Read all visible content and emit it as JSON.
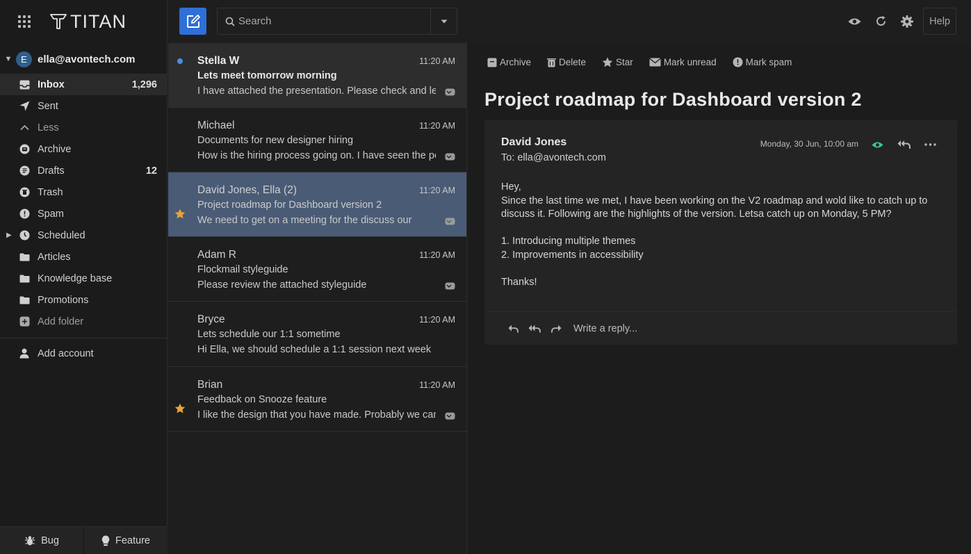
{
  "app": {
    "name": "TITAN"
  },
  "colors": {
    "accent": "#2f6fd6",
    "selected_row": "#4a5b76",
    "star": "#e8a23c",
    "unread_dot": "#4c8fe0",
    "eye_active": "#39c98a"
  },
  "search": {
    "placeholder": "Search"
  },
  "topbar": {
    "help_label": "Help",
    "icons": [
      "eye-icon",
      "refresh-icon",
      "gear-icon"
    ]
  },
  "account": {
    "avatar_letter": "E",
    "email": "ella@avontech.com"
  },
  "folders": [
    {
      "label": "Inbox",
      "count": "1,296",
      "icon": "inbox-icon",
      "active": true
    },
    {
      "label": "Sent",
      "count": "",
      "icon": "send-icon"
    },
    {
      "label": "Less",
      "count": "",
      "icon": "chevron-up-icon"
    },
    {
      "label": "Archive",
      "count": "",
      "icon": "archive-icon"
    },
    {
      "label": "Drafts",
      "count": "12",
      "icon": "drafts-icon"
    },
    {
      "label": "Trash",
      "count": "",
      "icon": "trash-icon"
    },
    {
      "label": "Spam",
      "count": "",
      "icon": "spam-icon"
    },
    {
      "label": "Scheduled",
      "count": "",
      "icon": "clock-icon"
    },
    {
      "label": "Articles",
      "count": "",
      "icon": "folder-icon"
    },
    {
      "label": "Knowledge base",
      "count": "",
      "icon": "folder-icon"
    },
    {
      "label": "Promotions",
      "count": "",
      "icon": "folder-icon"
    },
    {
      "label": "Add folder",
      "count": "",
      "icon": "add-folder-icon"
    }
  ],
  "add_account_label": "Add account",
  "sidebar_footer": {
    "bug_label": "Bug",
    "feature_label": "Feature"
  },
  "messages": [
    {
      "sender": "Stella W",
      "time": "11:20 AM",
      "subject": "Lets meet tomorrow morning",
      "preview": "I have attached the presentation. Please check and let me know",
      "unread": true,
      "starred": false,
      "selected": false
    },
    {
      "sender": "Michael",
      "time": "11:20 AM",
      "subject": "Documents for new designer hiring",
      "preview": "How is the hiring process going on. I have seen the portfolio",
      "unread": false,
      "starred": false,
      "selected": false
    },
    {
      "sender": "David Jones, Ella (2)",
      "time": "11:20 AM",
      "subject": "Project roadmap for Dashboard version 2",
      "preview": "We need to get on a meeting for the discuss our",
      "unread": false,
      "starred": true,
      "selected": true
    },
    {
      "sender": "Adam R",
      "time": "11:20 AM",
      "subject": "Flockmail styleguide",
      "preview": "Please review the attached styleguide",
      "unread": false,
      "starred": false,
      "selected": false
    },
    {
      "sender": "Bryce",
      "time": "11:20 AM",
      "subject": "Lets schedule our 1:1 sometime",
      "preview": "Hi Ella, we should schedule a 1:1 session next week",
      "unread": false,
      "starred": false,
      "selected": false
    },
    {
      "sender": "Brian",
      "time": "11:20 AM",
      "subject": "Feedback on Snooze feature",
      "preview": "I like the design that you have made. Probably we can",
      "unread": false,
      "starred": true,
      "selected": false
    }
  ],
  "reader": {
    "toolbar": {
      "archive": "Archive",
      "delete": "Delete",
      "star": "Star",
      "mark_unread": "Mark unread",
      "mark_spam": "Mark spam"
    },
    "title": "Project roadmap for Dashboard version 2",
    "email": {
      "from": "David Jones",
      "to": "To: ella@avontech.com",
      "date": "Monday, 30 Jun, 10:00 am",
      "body": {
        "greeting": "Hey,",
        "para1": "Since the last time we met, I have been working on the V2 roadmap and wold like to catch up to discuss it. Following are the highlights of the version. Letsa catch up on Monday, 5 PM?",
        "item1": "1. Introducing multiple themes",
        "item2": "2. Improvements in accessibility",
        "signoff": "Thanks!"
      }
    },
    "reply_placeholder": "Write a reply..."
  }
}
